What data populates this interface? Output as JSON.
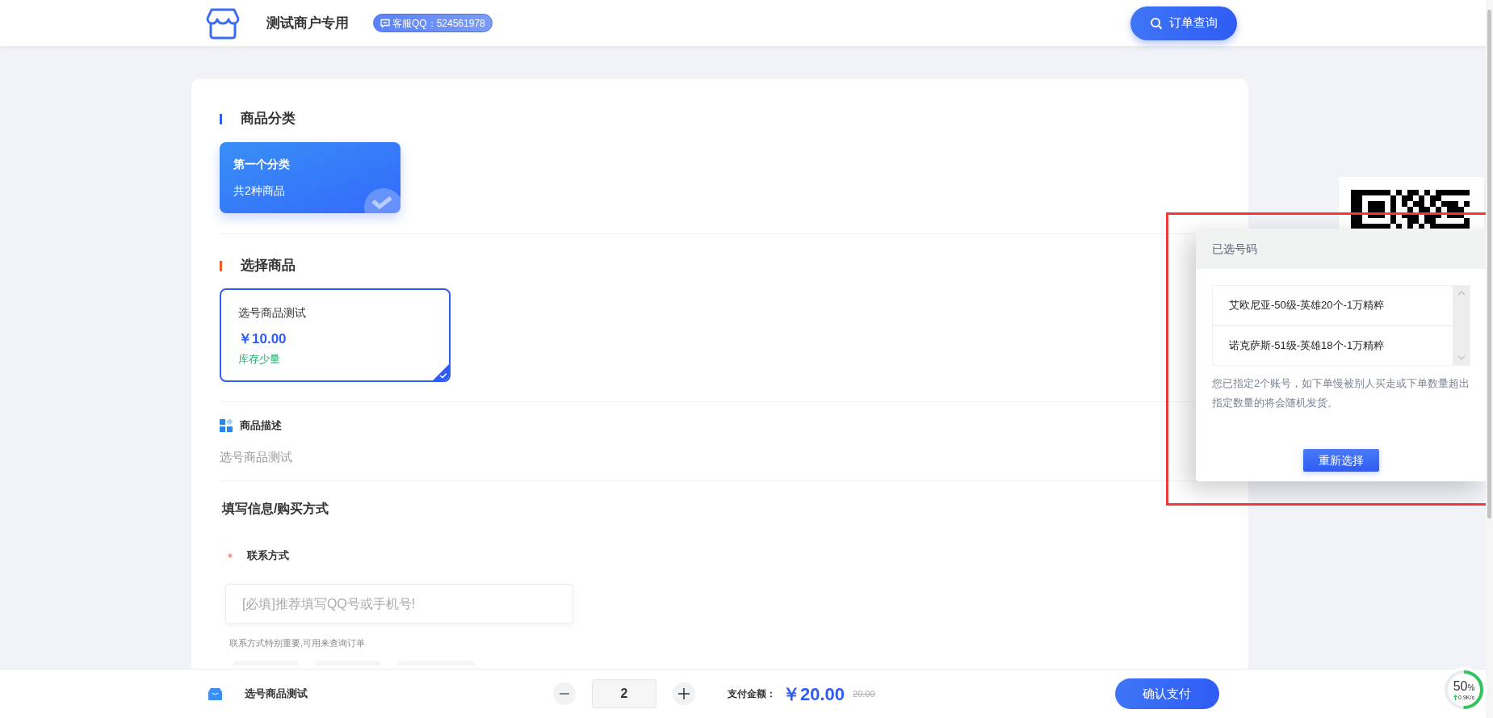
{
  "header": {
    "title": "测试商户专用",
    "support_badge": "客服QQ：524561978",
    "order_query_button": "订单查询"
  },
  "category_section": {
    "title": "商品分类",
    "categories": [
      {
        "name": "第一个分类",
        "count": "共2种商品",
        "selected": true
      }
    ]
  },
  "product_section": {
    "title": "选择商品",
    "products": [
      {
        "name": "选号商品测试",
        "price": "￥10.00",
        "stock": "库存少量",
        "selected": true
      }
    ]
  },
  "description": {
    "title": "商品描述",
    "text": "选号商品测试"
  },
  "form": {
    "title": "填写信息/购买方式",
    "fields": [
      {
        "label": "联系方式",
        "required": true,
        "placeholder": "[必填]推荐填写QQ号或手机号!",
        "hint": "联系方式特别重要,可用来查询订单"
      }
    ]
  },
  "bottom_bar": {
    "product_name": "选号商品测试",
    "quantity": "2",
    "amount_label": "支付金额：",
    "amount": "￥20.00",
    "original_amount": "20.00",
    "pay_button": "确认支付"
  },
  "selected_popup": {
    "title": "已选号码",
    "items": [
      "艾欧尼亚-50级-英雄20个-1万精粹",
      "诺克萨斯-51级-英雄18个-1万精粹"
    ],
    "note": "您已指定2个账号，如下单慢被别人买走或下单数量超出指定数量的将会随机发货。",
    "reselect_button": "重新选择"
  },
  "net_monitor": {
    "percent": "50",
    "unit": "%",
    "level": 0.5,
    "speed": "0.9K/s"
  }
}
